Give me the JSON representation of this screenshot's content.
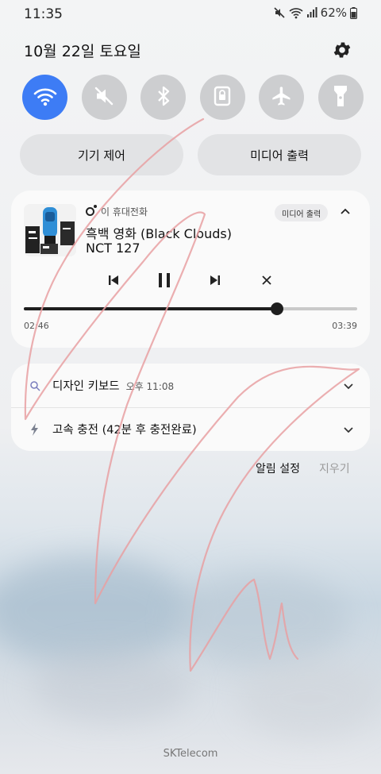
{
  "status_bar": {
    "time": "11:35",
    "battery": "62%"
  },
  "header": {
    "date": "10월 22일 토요일"
  },
  "quick_settings": [
    {
      "name": "wifi",
      "icon": "wifi-icon",
      "active": true
    },
    {
      "name": "sound",
      "icon": "mute-icon",
      "active": false
    },
    {
      "name": "bluetooth",
      "icon": "bluetooth-icon",
      "active": false
    },
    {
      "name": "lock",
      "icon": "lock-icon",
      "active": false
    },
    {
      "name": "airplane",
      "icon": "airplane-icon",
      "active": false
    },
    {
      "name": "flashlight",
      "icon": "flashlight-icon",
      "active": false
    }
  ],
  "pills": {
    "device_control": "기기 제어",
    "media_output": "미디어 출력"
  },
  "media": {
    "source": "이 휴대전화",
    "output_chip": "미디어 출력",
    "title": "흑백 영화 (Black Clouds)",
    "artist": "NCT 127",
    "elapsed": "02:46",
    "total": "03:39",
    "progress": 0.76
  },
  "notifications": [
    {
      "title": "디자인 키보드",
      "time": "오후 11:08",
      "icon": "search-icon"
    },
    {
      "title": "고속 충전 (42분 후 충전완료)",
      "time": "",
      "icon": "bolt-icon"
    }
  ],
  "footer": {
    "settings": "알림 설정",
    "clear": "지우기"
  },
  "carrier": "SKTelecom",
  "colors": {
    "accent": "#3d7cf5",
    "tile_off": "#cdced0",
    "scribble": "#e8a0a2"
  }
}
